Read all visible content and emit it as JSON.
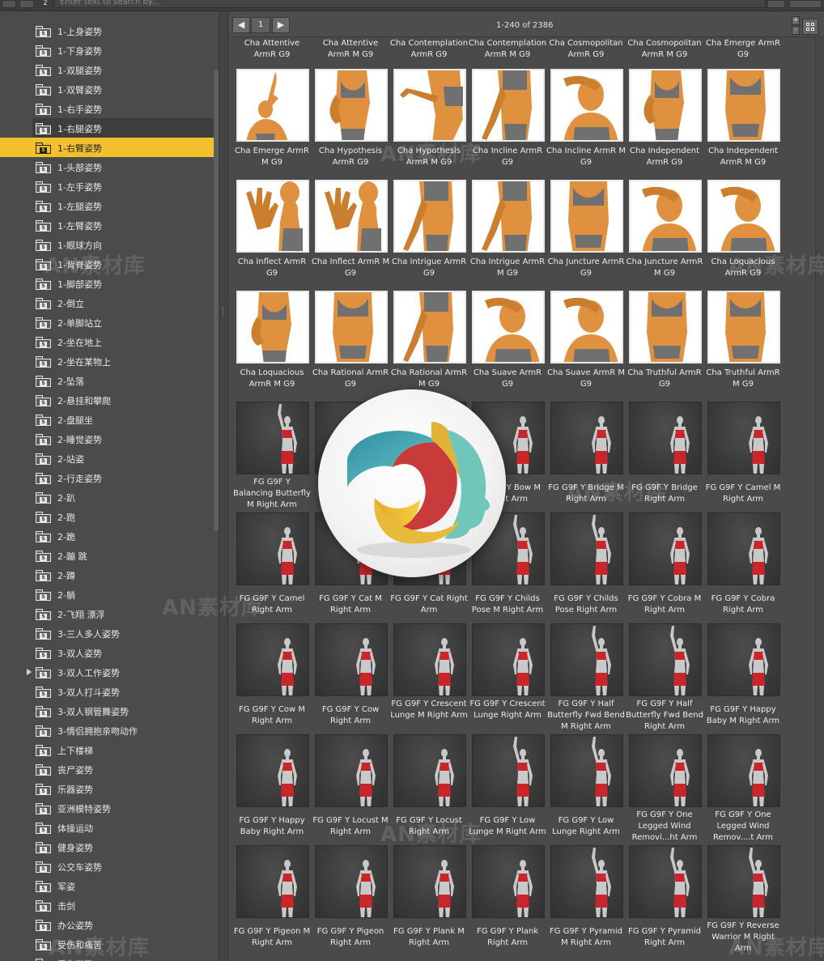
{
  "search": {
    "placeholder": "Enter text to search by..."
  },
  "tree": {
    "items": [
      {
        "label": "1-上身姿势"
      },
      {
        "label": "1-下身姿势"
      },
      {
        "label": "1-双腿姿势"
      },
      {
        "label": "1-双臂姿势"
      },
      {
        "label": "1-右手姿势"
      },
      {
        "label": "1-右腿姿势",
        "state": "hover"
      },
      {
        "label": "1-右臂姿势",
        "state": "selected"
      },
      {
        "label": "1-头部姿势"
      },
      {
        "label": "1-左手姿势"
      },
      {
        "label": "1-左腿姿势"
      },
      {
        "label": "1-左臂姿势"
      },
      {
        "label": "1-眼球方向"
      },
      {
        "label": "1-背脊姿势"
      },
      {
        "label": "1-脚部姿势"
      },
      {
        "label": "2-倒立"
      },
      {
        "label": "2-单脚站立"
      },
      {
        "label": "2-坐在地上"
      },
      {
        "label": "2-坐在某物上"
      },
      {
        "label": "2-坠落"
      },
      {
        "label": "2-悬挂和攀爬"
      },
      {
        "label": "2-盘腿坐"
      },
      {
        "label": "2-睡觉姿势"
      },
      {
        "label": "2-站姿"
      },
      {
        "label": "2-行走姿势"
      },
      {
        "label": "2-趴"
      },
      {
        "label": "2-跑"
      },
      {
        "label": "2-跪"
      },
      {
        "label": "2-蹦 跳"
      },
      {
        "label": "2-蹲"
      },
      {
        "label": "2-躺"
      },
      {
        "label": "2-飞翔 漂浮"
      },
      {
        "label": "3-三人多人姿势"
      },
      {
        "label": "3-双人姿势"
      },
      {
        "label": "3-双人工作姿势",
        "expandable": true
      },
      {
        "label": "3-双人打斗姿势"
      },
      {
        "label": "3-双人钢管舞姿势"
      },
      {
        "label": "3-情侣拥抱亲吻动作"
      },
      {
        "label": "上下楼梯"
      },
      {
        "label": "丧尸姿势"
      },
      {
        "label": "乐器姿势"
      },
      {
        "label": "亚洲模特姿势"
      },
      {
        "label": "体操运动"
      },
      {
        "label": "健身姿势"
      },
      {
        "label": "公交车姿势"
      },
      {
        "label": "军姿"
      },
      {
        "label": "击剑"
      },
      {
        "label": "办公姿势"
      },
      {
        "label": "受伤和痛苦"
      },
      {
        "label": "受伤姿势"
      }
    ]
  },
  "pager": {
    "prev_label": "◀",
    "page": "1",
    "next_label": "▶",
    "count": "1-240 of 2386",
    "zoom_in": "+",
    "zoom_out": "-"
  },
  "grid": {
    "top_partial_labels": [
      "Cha Attentive ArmR G9",
      "Cha Attentive ArmR M G9",
      "Cha Contemplation ArmR G9",
      "Cha Contemplation ArmR M G9",
      "Cha Cosmopolitan ArmR G9",
      "Cha Cosmopolitan ArmR M G9",
      "Cha Emerge ArmR G9"
    ],
    "rows": [
      [
        {
          "label": "Cha Emerge ArmR M G9",
          "style": "white",
          "pose": "arm-up"
        },
        {
          "label": "Cha Hypothesis ArmR G9",
          "style": "white",
          "pose": "torso-hip"
        },
        {
          "label": "Cha Hypothesis ArmR M G9",
          "style": "white",
          "pose": "hand"
        },
        {
          "label": "Cha Incline ArmR G9",
          "style": "white",
          "pose": "arm-side"
        },
        {
          "label": "Cha Incline ArmR M G9",
          "style": "white",
          "pose": "head-arm"
        },
        {
          "label": "Cha Independent ArmR G9",
          "style": "white",
          "pose": "torso-hip"
        },
        {
          "label": "Cha Independent ArmR M G9",
          "style": "white",
          "pose": "torso"
        }
      ],
      [
        {
          "label": "Cha Inflect ArmR G9",
          "style": "white",
          "pose": "hand-open"
        },
        {
          "label": "Cha Inflect ArmR M G9",
          "style": "white",
          "pose": "hand-open"
        },
        {
          "label": "Cha Intrigue ArmR G9",
          "style": "white",
          "pose": "arm-side"
        },
        {
          "label": "Cha Intrigue ArmR M G9",
          "style": "white",
          "pose": "arm-side"
        },
        {
          "label": "Cha Juncture ArmR G9",
          "style": "white",
          "pose": "torso"
        },
        {
          "label": "Cha Juncture ArmR M G9",
          "style": "white",
          "pose": "head-arm"
        },
        {
          "label": "Cha Loquacious ArmR G9",
          "style": "white",
          "pose": "head-arm"
        }
      ],
      [
        {
          "label": "Cha Loquacious ArmR M G9",
          "style": "white",
          "pose": "torso-hip"
        },
        {
          "label": "Cha Rational ArmR G9",
          "style": "white",
          "pose": "torso"
        },
        {
          "label": "Cha Rational ArmR M G9",
          "style": "white",
          "pose": "arm-side"
        },
        {
          "label": "Cha Suave ArmR G9",
          "style": "white",
          "pose": "head-arm"
        },
        {
          "label": "Cha Suave ArmR M G9",
          "style": "white",
          "pose": "head-arm"
        },
        {
          "label": "Cha Truthful ArmR G9",
          "style": "white",
          "pose": "torso"
        },
        {
          "label": "Cha Truthful ArmR M G9",
          "style": "white",
          "pose": "torso"
        }
      ],
      [
        {
          "label": "FG G9F Y Balancing Butterfly M Right Arm",
          "style": "dark",
          "pose": "fig-arm-up"
        },
        {
          "label": "",
          "style": "dark",
          "pose": "fig"
        },
        {
          "label": "",
          "style": "dark",
          "pose": "fig"
        },
        {
          "label": "FG G9F Y Bow M Right Arm",
          "style": "dark",
          "pose": "fig"
        },
        {
          "label": "FG G9F Y Bridge M Right Arm",
          "style": "dark",
          "pose": "fig"
        },
        {
          "label": "FG G9F Y Bridge Right Arm",
          "style": "dark",
          "pose": "fig"
        },
        {
          "label": "FG G9F Y Camel M Right Arm",
          "style": "dark",
          "pose": "fig"
        }
      ],
      [
        {
          "label": "FG G9F Y Camel Right Arm",
          "style": "dark",
          "pose": "fig"
        },
        {
          "label": "FG G9F Y Cat M Right Arm",
          "style": "dark",
          "pose": "fig"
        },
        {
          "label": "FG G9F Y Cat Right Arm",
          "style": "dark",
          "pose": "fig"
        },
        {
          "label": "FG G9F Y Childs Pose M Right Arm",
          "style": "dark",
          "pose": "fig-arm-up"
        },
        {
          "label": "FG G9F Y Childs Pose Right Arm",
          "style": "dark",
          "pose": "fig-arm-up"
        },
        {
          "label": "FG G9F Y Cobra M Right Arm",
          "style": "dark",
          "pose": "fig"
        },
        {
          "label": "FG G9F Y Cobra Right Arm",
          "style": "dark",
          "pose": "fig"
        }
      ],
      [
        {
          "label": "FG G9F Y Cow M Right Arm",
          "style": "dark",
          "pose": "fig"
        },
        {
          "label": "FG G9F Y Cow Right Arm",
          "style": "dark",
          "pose": "fig"
        },
        {
          "label": "FG G9F Y Crescent Lunge M Right Arm",
          "style": "dark",
          "pose": "fig"
        },
        {
          "label": "FG G9F Y Crescent Lunge Right Arm",
          "style": "dark",
          "pose": "fig"
        },
        {
          "label": "FG G9F Y Half Butterfly Fwd Bend M Right Arm",
          "style": "dark",
          "pose": "fig-arm-up"
        },
        {
          "label": "FG G9F Y Half Butterfly Fwd Bend Right Arm",
          "style": "dark",
          "pose": "fig-arm-up"
        },
        {
          "label": "FG G9F Y Happy Baby M Right Arm",
          "style": "dark",
          "pose": "fig"
        }
      ],
      [
        {
          "label": "FG G9F Y Happy Baby Right Arm",
          "style": "dark",
          "pose": "fig"
        },
        {
          "label": "FG G9F Y Locust M Right Arm",
          "style": "dark",
          "pose": "fig"
        },
        {
          "label": "FG G9F Y Locust Right Arm",
          "style": "dark",
          "pose": "fig"
        },
        {
          "label": "FG G9F Y Low Lunge M Right Arm",
          "style": "dark",
          "pose": "fig-arm-up"
        },
        {
          "label": "FG G9F Y Low Lunge Right Arm",
          "style": "dark",
          "pose": "fig-arm-up"
        },
        {
          "label": "FG G9F Y One Legged Wind Removi...ht Arm",
          "style": "dark",
          "pose": "fig"
        },
        {
          "label": "FG G9F Y One Legged Wind Remov....t Arm",
          "style": "dark",
          "pose": "fig"
        }
      ],
      [
        {
          "label": "FG G9F Y Pigeon M Right Arm",
          "style": "dark",
          "pose": "fig"
        },
        {
          "label": "FG G9F Y Pigeon Right Arm",
          "style": "dark",
          "pose": "fig"
        },
        {
          "label": "FG G9F Y Plank M Right Arm",
          "style": "dark",
          "pose": "fig"
        },
        {
          "label": "FG G9F Y Plank Right Arm",
          "style": "dark",
          "pose": "fig"
        },
        {
          "label": "FG G9F Y Pyramid M Right Arm",
          "style": "dark",
          "pose": "fig-arm-up"
        },
        {
          "label": "FG G9F Y Pyramid Right Arm",
          "style": "dark",
          "pose": "fig-arm-up"
        },
        {
          "label": "FG G9F Y Reverse Warrior M Right Arm",
          "style": "dark",
          "pose": "fig-arm-up"
        }
      ]
    ]
  },
  "watermark": {
    "text": "AN素材库"
  },
  "overlay": {
    "name": "application logo"
  },
  "colors": {
    "selection": "#f2c02d",
    "panel": "#4b4b4b",
    "skin": "#e0913f",
    "outfit": "#c8262b"
  }
}
